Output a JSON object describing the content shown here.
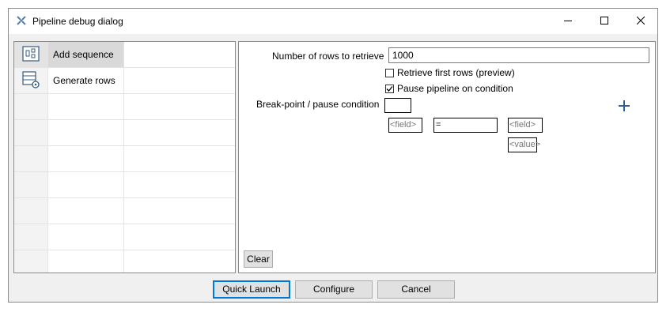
{
  "window": {
    "title": "Pipeline debug dialog",
    "icons": {
      "app": "pipeline-cross-icon",
      "minimize": "minimize-icon",
      "maximize": "maximize-icon",
      "close": "close-icon"
    }
  },
  "transforms": [
    {
      "label": "Add sequence",
      "icon": "add-sequence-icon",
      "selected": true
    },
    {
      "label": "Generate rows",
      "icon": "generate-rows-icon",
      "selected": false
    }
  ],
  "form": {
    "rows_label": "Number of rows to retrieve",
    "rows_value": "1000",
    "retrieve_first_label": "Retrieve first rows (preview)",
    "retrieve_first_checked": false,
    "pause_label": "Pause pipeline on condition",
    "pause_checked": true,
    "condition_label": "Break-point / pause condition",
    "left_field": "<field>",
    "operator": "=",
    "right_field": "<field>",
    "right_value": "<value>",
    "add_condition_icon": "plus-icon",
    "clear_label": "Clear"
  },
  "buttons": {
    "quick_launch": "Quick Launch",
    "configure": "Configure",
    "cancel": "Cancel"
  },
  "colors": {
    "accent": "#0078d7",
    "plus": "#2e5e8e"
  }
}
